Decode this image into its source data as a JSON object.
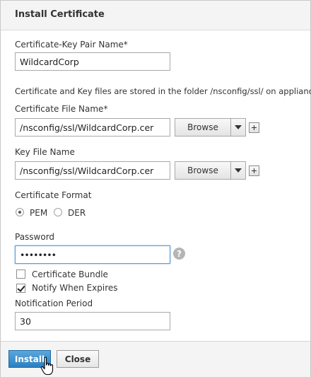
{
  "dialog": {
    "title": "Install Certificate"
  },
  "cert_key_pair": {
    "label": "Certificate-Key Pair Name*",
    "value": "WildcardCorp"
  },
  "info_text": "Certificate and Key files are stored in the folder /nsconfig/ssl/ on appliance.",
  "cert_file": {
    "label": "Certificate File Name*",
    "value": "/nsconfig/ssl/WildcardCorp.cer",
    "browse_label": "Browse"
  },
  "key_file": {
    "label": "Key File Name",
    "value": "/nsconfig/ssl/WildcardCorp.cer",
    "browse_label": "Browse"
  },
  "cert_format": {
    "label": "Certificate Format",
    "options": [
      "PEM",
      "DER"
    ],
    "selected": "PEM"
  },
  "password": {
    "label": "Password",
    "value": "••••••••"
  },
  "certificate_bundle": {
    "label": "Certificate Bundle",
    "checked": false
  },
  "notify_expires": {
    "label": "Notify When Expires",
    "checked": true
  },
  "notification_period": {
    "label": "Notification Period",
    "value": "30"
  },
  "footer": {
    "install_label": "Install",
    "close_label": "Close"
  },
  "colors": {
    "primary_button": "#2a80c2",
    "header_bg": "#f4f4f4",
    "focus_border": "#5b9bd5"
  }
}
